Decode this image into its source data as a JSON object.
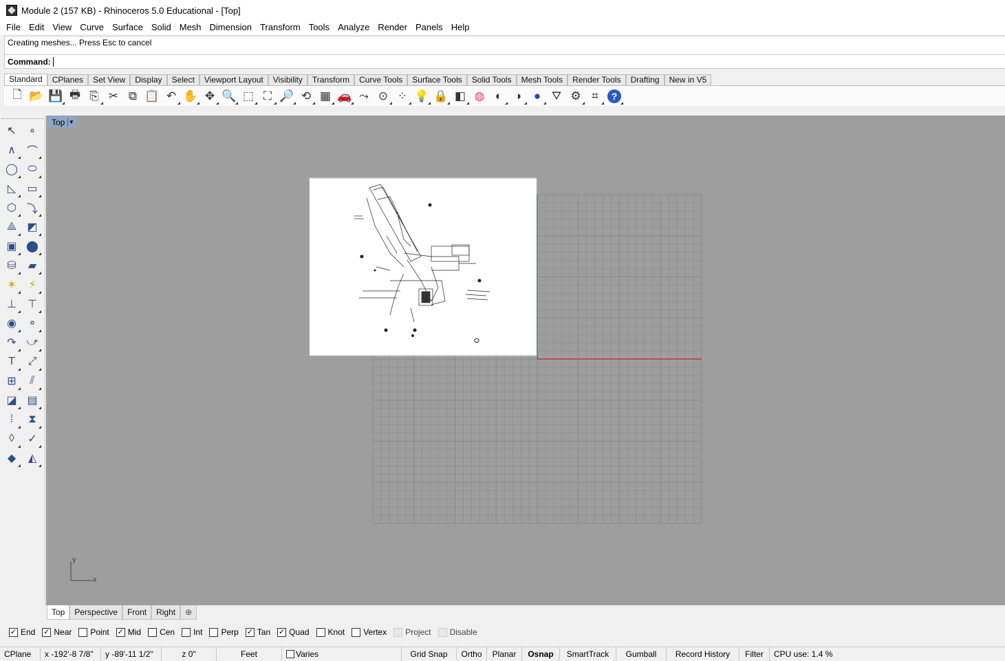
{
  "window": {
    "title": "Module 2 (157 KB) - Rhinoceros 5.0 Educational - [Top]"
  },
  "menu": [
    "File",
    "Edit",
    "View",
    "Curve",
    "Surface",
    "Solid",
    "Mesh",
    "Dimension",
    "Transform",
    "Tools",
    "Analyze",
    "Render",
    "Panels",
    "Help"
  ],
  "command": {
    "history": "Creating meshes... Press Esc to cancel",
    "label": "Command:",
    "value": ""
  },
  "toolbar_tabs": [
    "Standard",
    "CPlanes",
    "Set View",
    "Display",
    "Select",
    "Viewport Layout",
    "Visibility",
    "Transform",
    "Curve Tools",
    "Surface Tools",
    "Solid Tools",
    "Mesh Tools",
    "Render Tools",
    "Drafting",
    "New in V5"
  ],
  "toolbar_active_tab": "Standard",
  "toolbar_buttons": [
    {
      "icon": "new-file-icon",
      "glyph": "🗋"
    },
    {
      "icon": "open-folder-icon",
      "glyph": "📂"
    },
    {
      "icon": "save-icon",
      "glyph": "💾"
    },
    {
      "icon": "print-icon",
      "glyph": "🖶"
    },
    {
      "icon": "export-icon",
      "glyph": "⎘"
    },
    {
      "icon": "cut-icon",
      "glyph": "✂"
    },
    {
      "icon": "copy-icon",
      "glyph": "⧉"
    },
    {
      "icon": "paste-icon",
      "glyph": "📋"
    },
    {
      "icon": "undo-icon",
      "glyph": "↶"
    },
    {
      "icon": "pan-hand-icon",
      "glyph": "✋"
    },
    {
      "icon": "rotate-view-icon",
      "glyph": "✥"
    },
    {
      "icon": "zoom-icon",
      "glyph": "🔍"
    },
    {
      "icon": "zoom-window-icon",
      "glyph": "⬚"
    },
    {
      "icon": "zoom-extents-icon",
      "glyph": "⛶"
    },
    {
      "icon": "zoom-selected-icon",
      "glyph": "🔎"
    },
    {
      "icon": "undo-view-icon",
      "glyph": "⟲"
    },
    {
      "icon": "four-viewports-icon",
      "glyph": "▦"
    },
    {
      "icon": "car-icon",
      "glyph": "🚗"
    },
    {
      "icon": "curve-select-icon",
      "glyph": "⤳"
    },
    {
      "icon": "circle-point-icon",
      "glyph": "⊙"
    },
    {
      "icon": "points-icon",
      "glyph": "⁘"
    },
    {
      "icon": "light-bulb-icon",
      "glyph": "💡"
    },
    {
      "icon": "lock-icon",
      "glyph": "🔒"
    },
    {
      "icon": "layers-icon",
      "glyph": "◧"
    },
    {
      "icon": "color-wheel-icon",
      "glyph": "◍"
    },
    {
      "icon": "shaded-sphere-icon",
      "glyph": "◐"
    },
    {
      "icon": "rendered-sphere-icon",
      "glyph": "◑"
    },
    {
      "icon": "render-sphere-icon",
      "glyph": "●"
    },
    {
      "icon": "lamp-icon",
      "glyph": "⛛"
    },
    {
      "icon": "options-gear-icon",
      "glyph": "⚙"
    },
    {
      "icon": "dimension-icon",
      "glyph": "⌗"
    },
    {
      "icon": "help-icon",
      "glyph": "?"
    }
  ],
  "sidebar_buttons": [
    {
      "icon": "select-arrow-icon",
      "glyph": "↖"
    },
    {
      "icon": "point-icon",
      "glyph": "∘"
    },
    {
      "icon": "polyline-icon",
      "glyph": "∧"
    },
    {
      "icon": "curve-control-points-icon",
      "glyph": "⌒"
    },
    {
      "icon": "circle-icon",
      "glyph": "◯"
    },
    {
      "icon": "ellipse-icon",
      "glyph": "⬭"
    },
    {
      "icon": "arc-icon",
      "glyph": "◺"
    },
    {
      "icon": "rectangle-icon",
      "glyph": "▭"
    },
    {
      "icon": "polygon-icon",
      "glyph": "⬡"
    },
    {
      "icon": "fillet-curve-icon",
      "glyph": "⤵"
    },
    {
      "icon": "surface-from-points-icon",
      "glyph": "⟁"
    },
    {
      "icon": "extrude-surface-icon",
      "glyph": "◩"
    },
    {
      "icon": "box-icon",
      "glyph": "▣"
    },
    {
      "icon": "sphere-union-icon",
      "glyph": "⬤"
    },
    {
      "icon": "cylinder-icon",
      "glyph": "⛁"
    },
    {
      "icon": "mesh-plane-icon",
      "glyph": "▰"
    },
    {
      "icon": "explode-icon",
      "glyph": "✶"
    },
    {
      "icon": "split-icon",
      "glyph": "⚡"
    },
    {
      "icon": "trim-icon",
      "glyph": "⊥"
    },
    {
      "icon": "split-surface-icon",
      "glyph": "⊤"
    },
    {
      "icon": "boolean-union-icon",
      "glyph": "◉"
    },
    {
      "icon": "boolean-split-icon",
      "glyph": "⚬"
    },
    {
      "icon": "fillet-edge-icon",
      "glyph": "↷"
    },
    {
      "icon": "blend-curve-icon",
      "glyph": "⤻"
    },
    {
      "icon": "text-icon",
      "glyph": "T"
    },
    {
      "icon": "scale-icon",
      "glyph": "⤢"
    },
    {
      "icon": "array-icon",
      "glyph": "⊞"
    },
    {
      "icon": "bend-icon",
      "glyph": "⫽"
    },
    {
      "icon": "block-icon",
      "glyph": "◪"
    },
    {
      "icon": "hatch-icon",
      "glyph": "▤"
    },
    {
      "icon": "grid-array-icon",
      "glyph": "⁞"
    },
    {
      "icon": "gumball-icon",
      "glyph": "⧗"
    },
    {
      "icon": "analyze-icon",
      "glyph": "◊"
    },
    {
      "icon": "check-icon",
      "glyph": "✓"
    },
    {
      "icon": "mesh-tools-icon",
      "glyph": "◆"
    },
    {
      "icon": "render-tools-icon",
      "glyph": "◭"
    }
  ],
  "viewport": {
    "name": "Top",
    "axes": {
      "x": "x",
      "y": "y"
    }
  },
  "viewport_tabs": [
    "Top",
    "Perspective",
    "Front",
    "Right"
  ],
  "viewport_active_tab": "Top",
  "osnaps": [
    {
      "label": "End",
      "checked": true,
      "enabled": true
    },
    {
      "label": "Near",
      "checked": true,
      "enabled": true
    },
    {
      "label": "Point",
      "checked": false,
      "enabled": true
    },
    {
      "label": "Mid",
      "checked": true,
      "enabled": true
    },
    {
      "label": "Cen",
      "checked": false,
      "enabled": true
    },
    {
      "label": "Int",
      "checked": false,
      "enabled": true
    },
    {
      "label": "Perp",
      "checked": false,
      "enabled": true
    },
    {
      "label": "Tan",
      "checked": true,
      "enabled": true
    },
    {
      "label": "Quad",
      "checked": true,
      "enabled": true
    },
    {
      "label": "Knot",
      "checked": false,
      "enabled": true
    },
    {
      "label": "Vertex",
      "checked": false,
      "enabled": true
    },
    {
      "label": "Project",
      "checked": false,
      "enabled": false
    },
    {
      "label": "Disable",
      "checked": false,
      "enabled": false
    }
  ],
  "status": {
    "cplane": "CPlane",
    "x": "x -192'-8 7/8\"",
    "y": "y -89'-11 1/2\"",
    "z": "z 0\"",
    "units": "Feet",
    "layer": "Varies",
    "toggles": [
      "Grid Snap",
      "Ortho",
      "Planar",
      "Osnap",
      "SmartTrack",
      "Gumball",
      "Record History",
      "Filter"
    ],
    "active_toggle": "Osnap",
    "cpu": "CPU use: 1.4 %"
  },
  "colors": {
    "viewport_bg": "#9e9e9e",
    "grid_line": "#8a8a8a",
    "x_axis": "#c0392b",
    "y_axis": "#2e8b3a",
    "viewport_title_bg": "#8fa5c4"
  }
}
